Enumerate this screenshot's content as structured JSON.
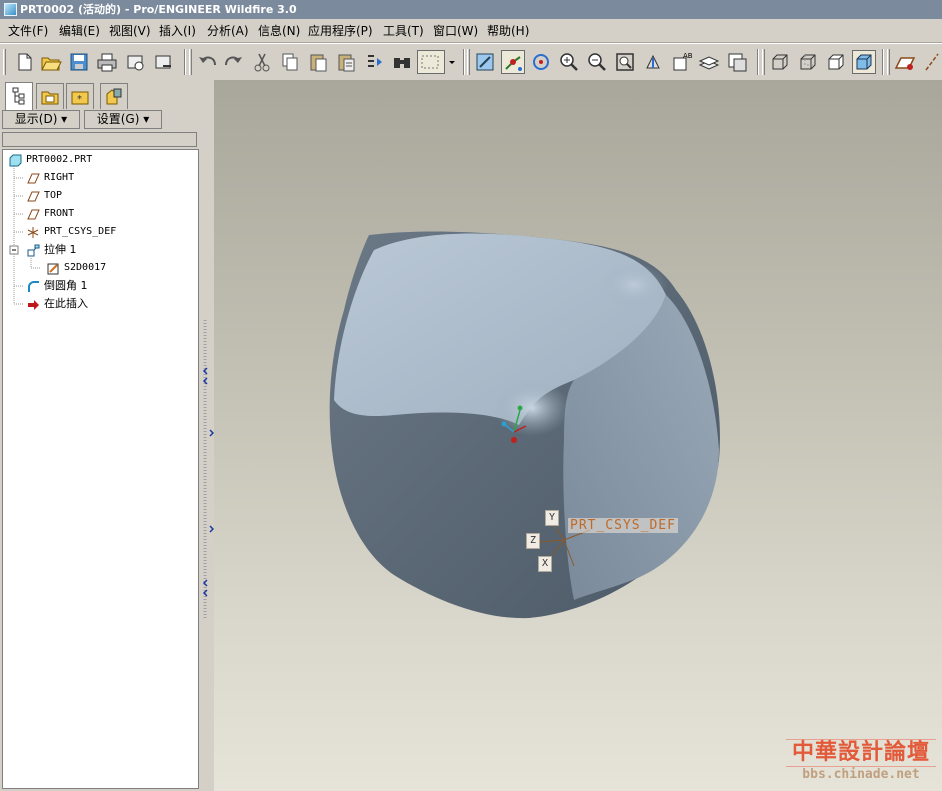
{
  "window": {
    "title": "PRT0002 (活动的) - Pro/ENGINEER Wildfire 3.0"
  },
  "menu": [
    "文件(F)",
    "编辑(E)",
    "视图(V)",
    "插入(I)",
    "分析(A)",
    "信息(N)",
    "应用程序(P)",
    "工具(T)",
    "窗口(W)",
    "帮助(H)"
  ],
  "navigator": {
    "show_label": "显示(D) ▾",
    "settings_label": "设置(G) ▾"
  },
  "tree": [
    {
      "label": "PRT0002.PRT",
      "icon": "part-icon"
    },
    {
      "label": "RIGHT",
      "icon": "datum-plane-icon"
    },
    {
      "label": "TOP",
      "icon": "datum-plane-icon"
    },
    {
      "label": "FRONT",
      "icon": "datum-plane-icon"
    },
    {
      "label": "PRT_CSYS_DEF",
      "icon": "csys-icon"
    },
    {
      "label": "拉伸 1",
      "icon": "extrude-icon"
    },
    {
      "label": "S2D0017",
      "icon": "sketch-icon"
    },
    {
      "label": "倒圆角 1",
      "icon": "round-icon"
    },
    {
      "label": "在此插入",
      "icon": "insert-here-arrow-icon"
    }
  ],
  "viewport": {
    "csys_label": "PRT_CSYS_DEF",
    "axes": {
      "y": "Y",
      "z": "Z",
      "x": "X"
    }
  },
  "watermark": {
    "line1": "中華設計論壇",
    "line2": "bbs.chinade.net"
  },
  "colors": {
    "title_bar": "#7b8a9c",
    "csys_label": "#c06a28",
    "model": "#8a99aa"
  }
}
